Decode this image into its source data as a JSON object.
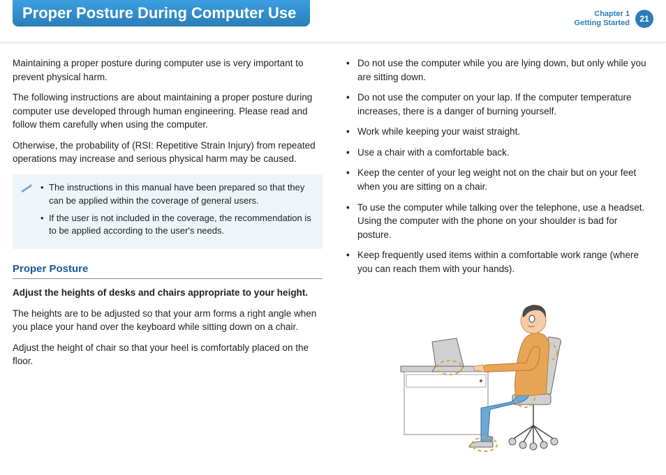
{
  "header": {
    "title": "Proper Posture During Computer Use",
    "chapter_line1": "Chapter 1",
    "chapter_line2": "Getting Started",
    "page_number": "21"
  },
  "left": {
    "p1": "Maintaining a proper posture during computer use is very important to prevent physical harm.",
    "p2": "The following instructions are about maintaining a proper posture during computer use developed through human engineering. Please read and follow them carefully when using the computer.",
    "p3": "Otherwise, the probability of (RSI: Repetitive Strain Injury) from repeated operations may increase and serious physical harm may be caused.",
    "note": [
      "The instructions in this manual have been prepared so that they can be applied within the coverage of general users.",
      "If the user is not included in the coverage, the recommendation is to be applied according to the user's needs."
    ],
    "section": "Proper Posture",
    "subhead": "Adjust the heights of desks and chairs appropriate to your height.",
    "p4": "The heights are to be adjusted so that your arm forms a right angle when you place your hand over the keyboard while sitting down on a chair.",
    "p5": "Adjust the height of chair so that your heel is comfortably placed on the floor."
  },
  "right": {
    "bullets": [
      "Do not use the computer while you are lying down, but only while you are sitting down.",
      "Do not use the computer on your lap. If the computer temperature increases, there is a danger of burning yourself.",
      "Work while keeping your waist straight.",
      "Use a chair with a comfortable back.",
      "Keep the center of your leg weight not on the chair but on your feet when you are sitting on a chair.",
      "To use the computer while talking over the telephone, use a headset. Using the computer with the phone on your shoulder is bad for posture.",
      "Keep frequently used items within a comfortable work range (where you can reach them with your hands)."
    ]
  }
}
